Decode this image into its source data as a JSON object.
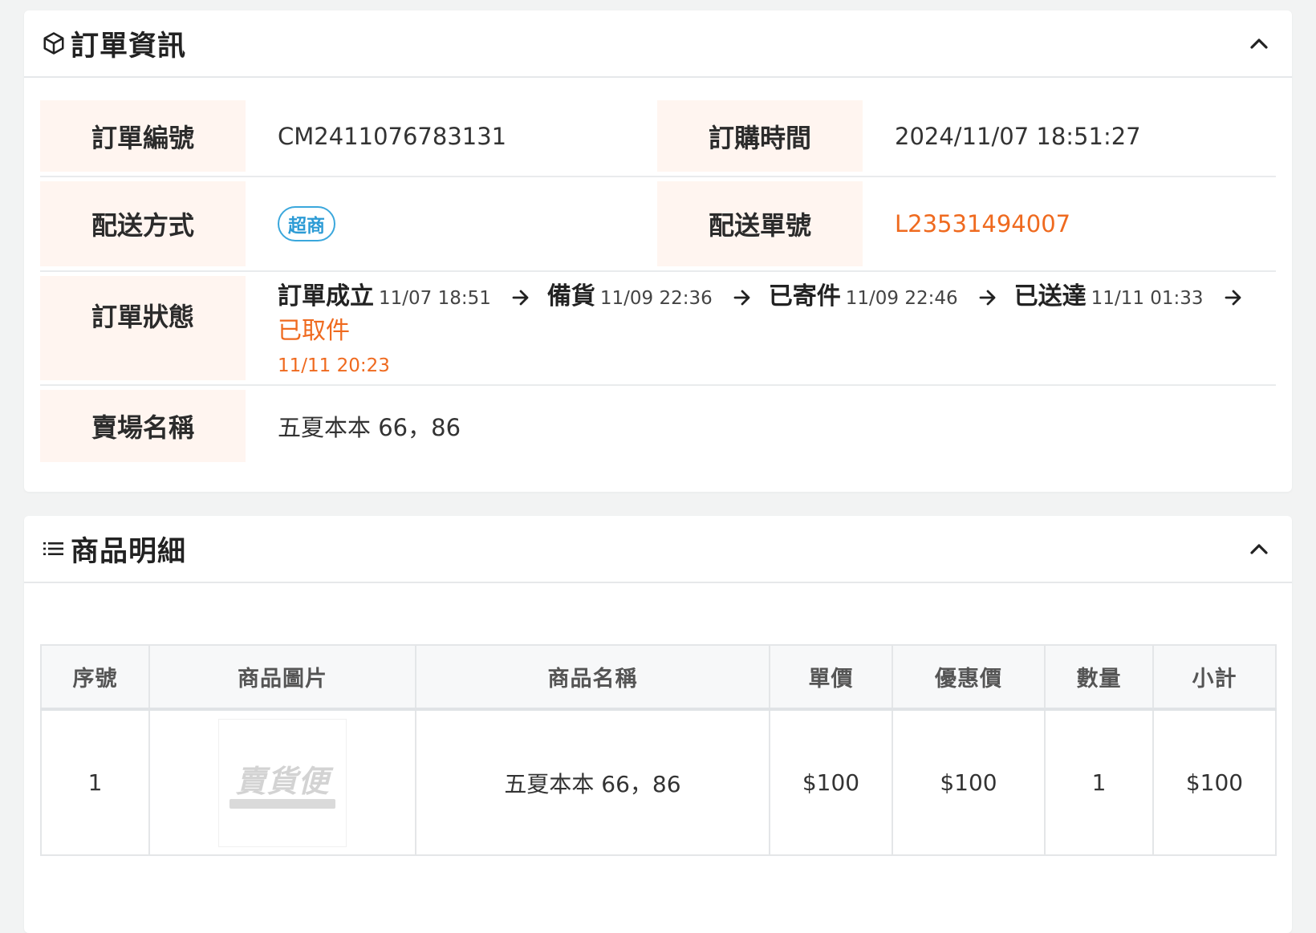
{
  "order_info": {
    "title": "訂單資訊",
    "icon": "cube-icon",
    "order_no_label": "訂單編號",
    "order_no": "CM2411076783131",
    "order_time_label": "訂購時間",
    "order_time": "2024/11/07 18:51:27",
    "shipping_method_label": "配送方式",
    "shipping_method": "超商",
    "tracking_no_label": "配送單號",
    "tracking_no": "L23531494007",
    "status_label": "訂單狀態",
    "status_steps": [
      {
        "name": "訂單成立",
        "time": "11/07 18:51"
      },
      {
        "name": "備貨",
        "time": "11/09 22:36"
      },
      {
        "name": "已寄件",
        "time": "11/09 22:46"
      },
      {
        "name": "已送達",
        "time": "11/11 01:33"
      },
      {
        "name": "已取件",
        "time": "11/11 20:23"
      }
    ],
    "store_name_label": "賣場名稱",
    "store_name": "五夏本本 66，86"
  },
  "items": {
    "title": "商品明細",
    "icon": "list-icon",
    "columns": [
      "序號",
      "商品圖片",
      "商品名稱",
      "單價",
      "優惠價",
      "數量",
      "小計"
    ],
    "rows": [
      {
        "index": "1",
        "image_watermark": "賣貨便",
        "name": "五夏本本 66，86",
        "price": "$100",
        "discount_price": "$100",
        "qty": "1",
        "subtotal": "$100"
      }
    ]
  },
  "colors": {
    "accent_orange": "#ef6a1f",
    "tag_blue": "#2c9bd5",
    "label_bg": "#fff5f0"
  }
}
